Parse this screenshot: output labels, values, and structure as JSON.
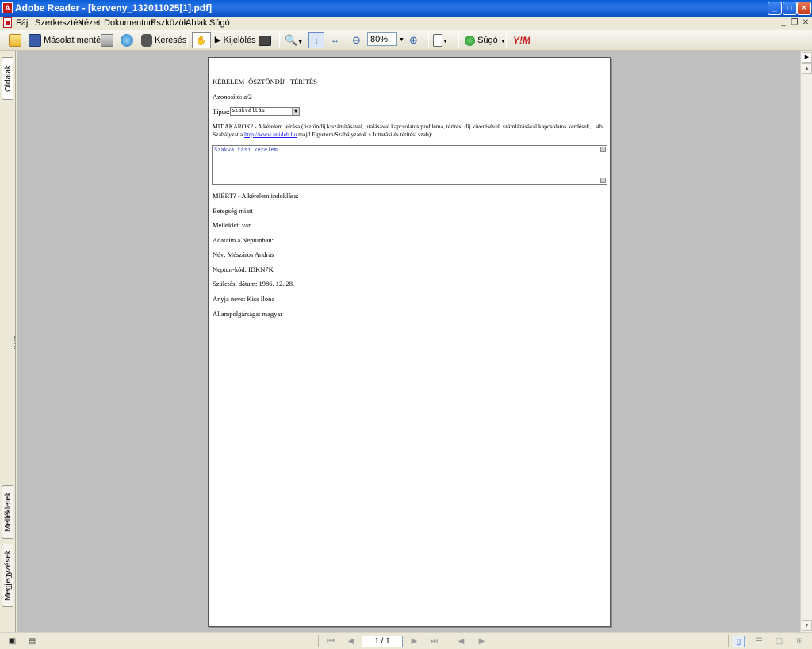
{
  "window": {
    "title": "Adobe Reader - [kerveny_132011025[1].pdf]",
    "app_icon": "pdf-icon",
    "controls": {
      "minimize": "_",
      "maximize": "□",
      "close": "✕"
    }
  },
  "menu": {
    "items": [
      "Fájl",
      "Szerkesztés",
      "Nézet",
      "Dokumentum",
      "Eszközök",
      "Ablak",
      "Súgó"
    ],
    "doc_controls": {
      "minimize": "_",
      "restore": "❐",
      "close": "✕"
    }
  },
  "toolbar": {
    "save_copy_label": "Másolat mentése",
    "search_label": "Keresés",
    "select_label": "Kijelölés",
    "zoom_value": "80%",
    "help_label": "Súgó",
    "yahoo_label": "Y!M"
  },
  "side_tabs": {
    "pages": "Oldalak",
    "attachments": "Mellékletek",
    "comments": "Megjegyzések"
  },
  "document": {
    "heading": "KÉRELEM -ÖSZTÖNDÍJ - TÉRÍTÉS",
    "id_line": "Azonosító: a/2",
    "type_label": "Típus:",
    "type_value": "szakváltás",
    "what_line1": "MIT AKAROK? - A kérelem leírása (ösztöndíj kiszámításával, utalásával kapcsolatos probléma, térítési díj kiverésével, számlázásával kapcsolatos kérdések, . stb,",
    "what_line2_prefix": "Szabályzat a",
    "what_link": "http://www.unideb.hu",
    "what_line2_suffix": "majd Egyetem/Szabályzatok s Juttatási és térítési szab):",
    "request_text": "Szakváltási kérelem",
    "why_line": "MIÉRT? - A kérelem indoklása:",
    "reason": "Betegség miatt",
    "attachment": "Melléklet: van",
    "neptun_header": "Adataim a Neptunban:",
    "name": "Név: Mészáros András",
    "neptun_code": "Neptun-kód: IDKN7K",
    "birth_date": "Születési dátum:  1986. 12. 28.",
    "mother_name": "Anyja neve: Kiss Ilona",
    "citizenship": "Állampolgársága: magyar"
  },
  "statusbar": {
    "page_indicator": "1 / 1"
  }
}
